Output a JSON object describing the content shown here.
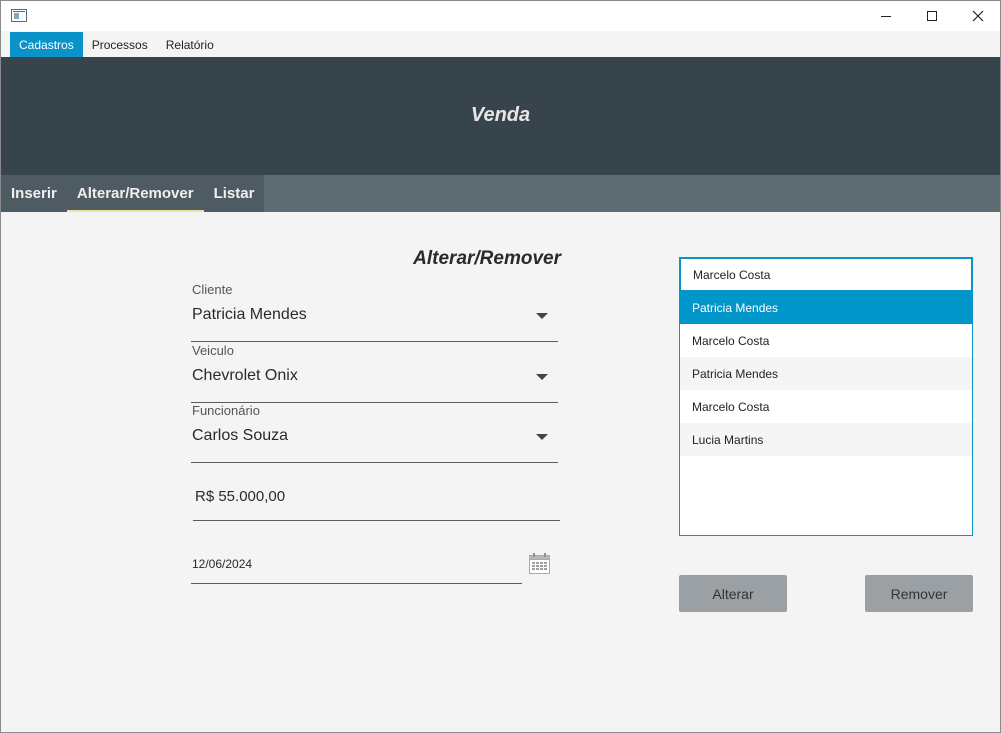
{
  "menu": {
    "items": [
      {
        "label": "Cadastros",
        "active": true
      },
      {
        "label": "Processos",
        "active": false
      },
      {
        "label": "Relatório",
        "active": false
      }
    ]
  },
  "header": {
    "title": "Venda"
  },
  "tabs": [
    {
      "label": "Inserir",
      "active": false
    },
    {
      "label": "Alterar/Remover",
      "active": true
    },
    {
      "label": "Listar",
      "active": false
    }
  ],
  "form": {
    "title": "Alterar/Remover",
    "cliente": {
      "label": "Cliente",
      "value": "Patricia Mendes"
    },
    "veiculo": {
      "label": "Veiculo",
      "value": "Chevrolet Onix"
    },
    "funcionario": {
      "label": "Funcionário",
      "value": "Carlos Souza"
    },
    "preco": {
      "value": "R$ 55.000,00"
    },
    "data": {
      "value": "12/06/2024",
      "icon": "calendar-icon"
    }
  },
  "list": {
    "items": [
      {
        "label": "Marcelo Costa"
      },
      {
        "label": "Patricia Mendes"
      },
      {
        "label": "Marcelo Costa"
      },
      {
        "label": "Patricia Mendes"
      },
      {
        "label": "Marcelo Costa"
      },
      {
        "label": "Lucia Martins"
      }
    ],
    "selected_index": 1,
    "focused_index": 0
  },
  "buttons": {
    "alterar": "Alterar",
    "remover": "Remover"
  },
  "colors": {
    "accent": "#0a93c9",
    "header_bg": "#37444b",
    "tabbar_bg": "#5f6b72",
    "button_bg": "#9aa0a4"
  }
}
